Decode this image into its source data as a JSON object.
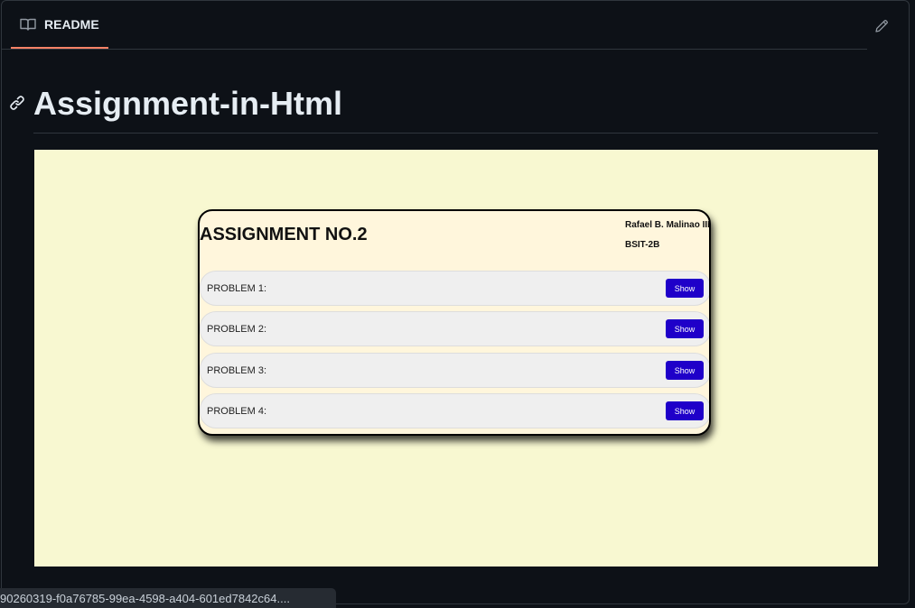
{
  "tabbar": {
    "tab_label": "README"
  },
  "readme": {
    "heading": "Assignment-in-Html"
  },
  "preview": {
    "card_title": "ASSIGNMENT NO.2",
    "author": "Rafael B. Malinao III",
    "section": "BSIT-2B",
    "problems": [
      {
        "label": "PROBLEM 1:",
        "button": "Show"
      },
      {
        "label": "PROBLEM 2:",
        "button": "Show"
      },
      {
        "label": "PROBLEM 3:",
        "button": "Show"
      },
      {
        "label": "PROBLEM 4:",
        "button": "Show"
      }
    ]
  },
  "status_tooltip": "90260319-f0a76785-99ea-4598-a404-601ed7842c64....",
  "colors": {
    "background": "#0d1117",
    "accent_underline": "#f78166",
    "preview_bg": "#f8f8d1",
    "show_button": "#1f00c9"
  },
  "icons": {
    "tab": "book-icon",
    "edit": "pencil-icon",
    "heading_anchor": "link-icon"
  }
}
